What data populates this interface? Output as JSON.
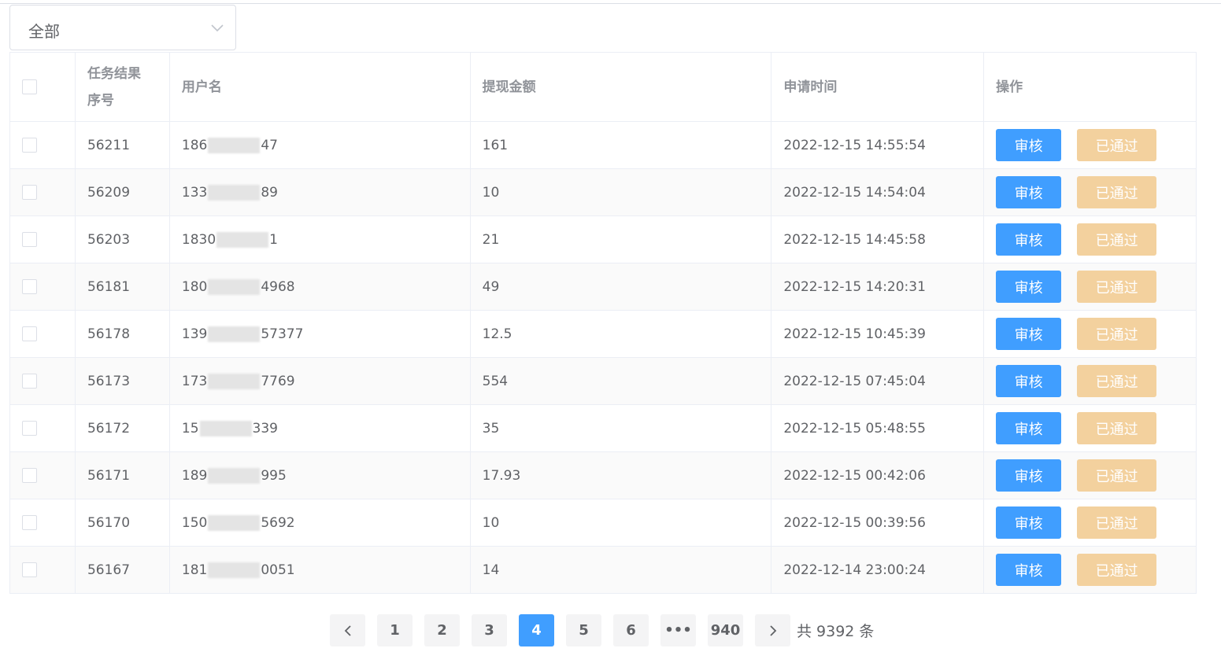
{
  "filter": {
    "selected": "全部"
  },
  "table": {
    "headers": {
      "seq_line1": "任务结果",
      "seq_line2": "序号",
      "username": "用户名",
      "amount": "提现金额",
      "time": "申请时间",
      "actions": "操作"
    },
    "rows": [
      {
        "id": "56211",
        "user_prefix": "186",
        "user_suffix": "47",
        "amount": "161",
        "time": "2022-12-15 14:55:54"
      },
      {
        "id": "56209",
        "user_prefix": "133",
        "user_suffix": "89",
        "amount": "10",
        "time": "2022-12-15 14:54:04"
      },
      {
        "id": "56203",
        "user_prefix": "1830",
        "user_suffix": "1",
        "amount": "21",
        "time": "2022-12-15 14:45:58"
      },
      {
        "id": "56181",
        "user_prefix": "180",
        "user_suffix": "4968",
        "amount": "49",
        "time": "2022-12-15 14:20:31"
      },
      {
        "id": "56178",
        "user_prefix": "139",
        "user_suffix": "57377",
        "amount": "12.5",
        "time": "2022-12-15 10:45:39"
      },
      {
        "id": "56173",
        "user_prefix": "173",
        "user_suffix": "7769",
        "amount": "554",
        "time": "2022-12-15 07:45:04"
      },
      {
        "id": "56172",
        "user_prefix": "15",
        "user_suffix": "339",
        "amount": "35",
        "time": "2022-12-15 05:48:55"
      },
      {
        "id": "56171",
        "user_prefix": "189",
        "user_suffix": "995",
        "amount": "17.93",
        "time": "2022-12-15 00:42:06"
      },
      {
        "id": "56170",
        "user_prefix": "150",
        "user_suffix": "5692",
        "amount": "10",
        "time": "2022-12-15 00:39:56"
      },
      {
        "id": "56167",
        "user_prefix": "181",
        "user_suffix": "0051",
        "amount": "14",
        "time": "2022-12-14 23:00:24"
      }
    ],
    "review_label": "审核",
    "passed_label": "已通过"
  },
  "pagination": {
    "pages": [
      "1",
      "2",
      "3",
      "4",
      "5",
      "6"
    ],
    "active": "4",
    "ellipsis": "•••",
    "last": "940",
    "total_text": "共 9392 条"
  },
  "colors": {
    "primary": "#409eff",
    "passed": "#f3d19e"
  }
}
